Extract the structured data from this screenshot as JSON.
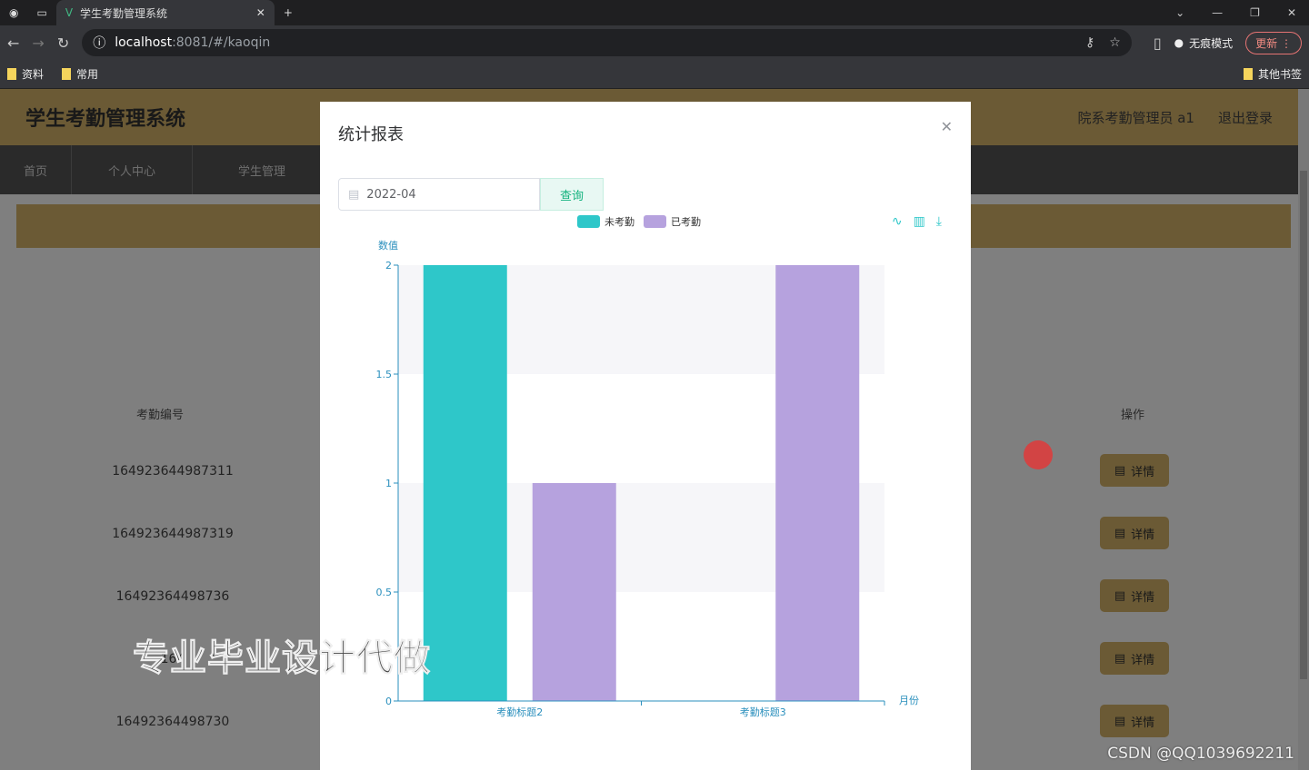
{
  "browser": {
    "tab_title": "学生考勤管理系统",
    "url_host": "localhost",
    "url_rest": ":8081/#/kaoqin",
    "incognito_label": "无痕模式",
    "update_label": "更新",
    "bookmarks": [
      "资料",
      "常用"
    ],
    "other_bookmarks": "其他书签"
  },
  "app": {
    "title": "学生考勤管理系统",
    "user": "院系考勤管理员 a1",
    "logout": "退出登录",
    "nav": [
      "首页",
      "个人中心",
      "学生管理"
    ]
  },
  "table": {
    "col_id": "考勤编号",
    "col_action": "操作",
    "ids": [
      "164923644987311",
      "164923644987319",
      "16492364498736",
      "164",
      "16492364498730"
    ],
    "detail_label": "详情"
  },
  "dialog": {
    "title": "统计报表",
    "date_value": "2022-04",
    "query_label": "查询"
  },
  "chart_data": {
    "type": "bar",
    "categories": [
      "考勤标题2",
      "考勤标题3"
    ],
    "series": [
      {
        "name": "未考勤",
        "values": [
          2,
          0
        ],
        "color": "#2ec7c9"
      },
      {
        "name": "已考勤",
        "values": [
          1,
          2
        ],
        "color": "#b6a2de"
      }
    ],
    "xlabel": "月份",
    "ylabel": "数值",
    "ylim": [
      0,
      2
    ],
    "yticks": [
      0,
      0.5,
      1,
      1.5,
      2
    ],
    "legend": "top-center",
    "grid": false,
    "split_area": true,
    "toolbox": [
      "line-chart-icon",
      "bar-chart-icon",
      "download-icon"
    ]
  },
  "overlay": {
    "watermark": "专业毕业设计代做",
    "credit": "CSDN @QQ1039692211"
  }
}
